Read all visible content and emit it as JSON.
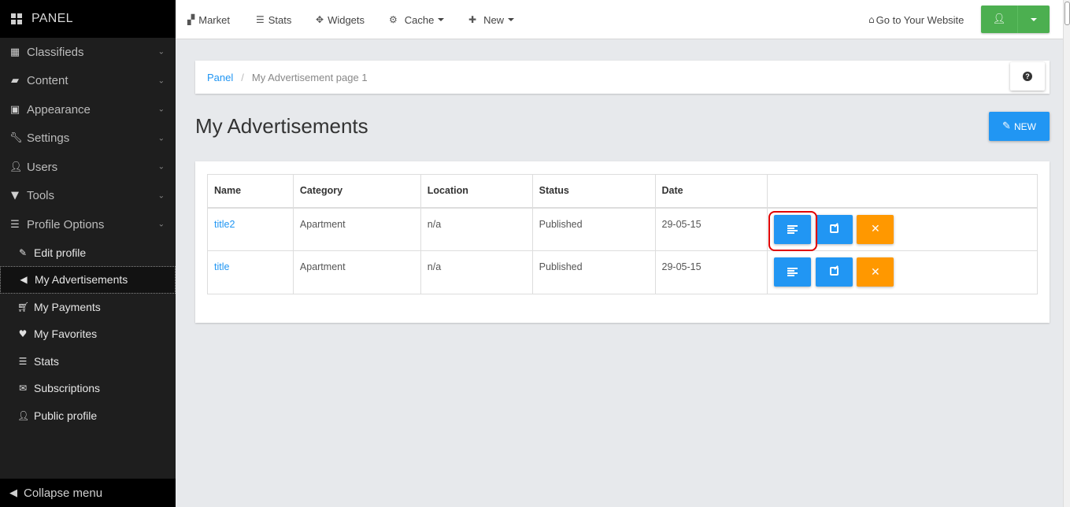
{
  "sidebar": {
    "brand": "PANEL",
    "menu": [
      {
        "label": "Classifieds",
        "icon": "grid-icon"
      },
      {
        "label": "Content",
        "icon": "folder-open-icon"
      },
      {
        "label": "Appearance",
        "icon": "picture-icon"
      },
      {
        "label": "Settings",
        "icon": "wrench-icon"
      },
      {
        "label": "Users",
        "icon": "user-icon"
      },
      {
        "label": "Tools",
        "icon": "filter-icon"
      },
      {
        "label": "Profile Options",
        "icon": "list-icon"
      }
    ],
    "submenu": [
      {
        "label": "Edit profile",
        "icon": "edit-icon"
      },
      {
        "label": "My Advertisements",
        "icon": "bullhorn-icon",
        "active": true
      },
      {
        "label": "My Payments",
        "icon": "cart-icon"
      },
      {
        "label": "My Favorites",
        "icon": "heart-icon"
      },
      {
        "label": "Stats",
        "icon": "align-left-icon"
      },
      {
        "label": "Subscriptions",
        "icon": "envelope-icon"
      },
      {
        "label": "Public profile",
        "icon": "user-icon"
      }
    ],
    "collapse_label": "Collapse menu"
  },
  "topbar": {
    "market": "Market",
    "stats": "Stats",
    "widgets": "Widgets",
    "cache": "Cache",
    "new": "New",
    "website": "Go to Your Website"
  },
  "breadcrumb": {
    "root": "Panel",
    "separator": "/",
    "current": "My Advertisement page 1"
  },
  "page": {
    "title": "My Advertisements",
    "new_button": "NEW"
  },
  "table": {
    "headers": [
      "Name",
      "Category",
      "Location",
      "Status",
      "Date"
    ],
    "rows": [
      {
        "name": "title2",
        "category": "Apartment",
        "location": "n/a",
        "status": "Published",
        "date": "29-05-15"
      },
      {
        "name": "title",
        "category": "Apartment",
        "location": "n/a",
        "status": "Published",
        "date": "29-05-15"
      }
    ]
  },
  "colors": {
    "primary": "#2196f3",
    "warning": "#ff9800",
    "success": "#4caf50",
    "sidebar": "#1e1e1e",
    "highlight": "#e00000"
  }
}
